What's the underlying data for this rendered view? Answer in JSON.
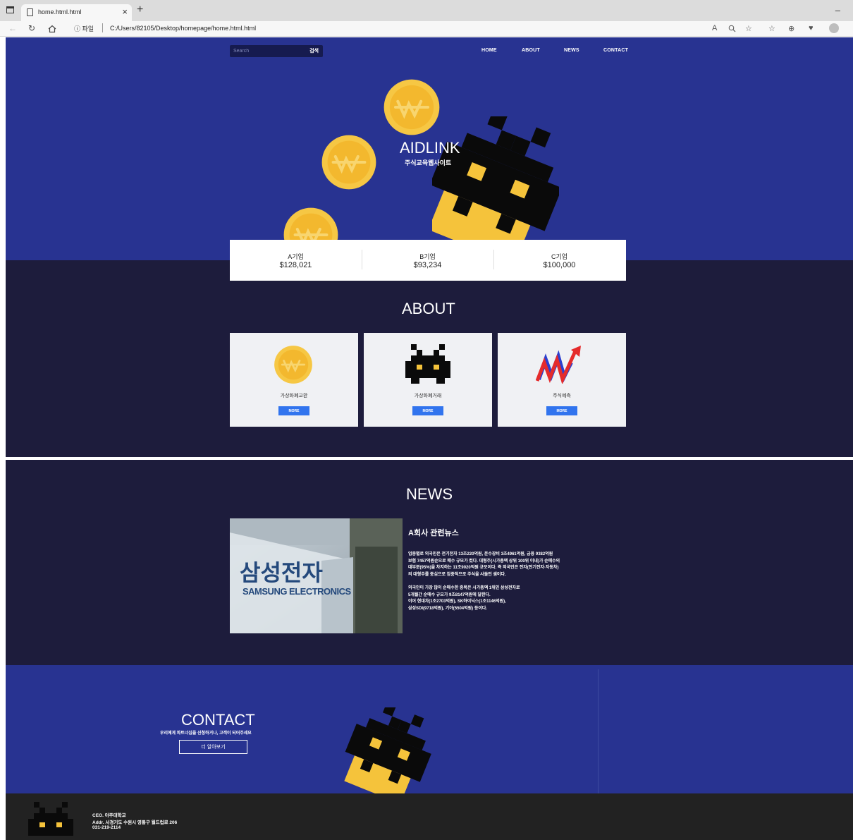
{
  "browser": {
    "tab_title": "home.html.html",
    "tab_close": "×",
    "new_tab": "+",
    "minimize": "–",
    "address_label": "ⓘ 파일",
    "address_url": "C:/Users/82105/Desktop/homepage/home.html.html"
  },
  "header": {
    "search_placeholder": "Search",
    "search_button": "검색",
    "nav": [
      "HOME",
      "ABOUT",
      "NEWS",
      "CONTACT"
    ]
  },
  "hero": {
    "title": "AIDLINK",
    "subtitle": "주식교육웹사이트"
  },
  "stats": [
    {
      "name": "A기업",
      "value": "$128,021"
    },
    {
      "name": "B기업",
      "value": "$93,234"
    },
    {
      "name": "C기업",
      "value": "$100,000"
    }
  ],
  "about": {
    "title": "ABOUT",
    "cards": [
      {
        "label": "가상화폐교환",
        "button": "MORE",
        "icon": "coin-icon"
      },
      {
        "label": "가상화폐거래",
        "button": "MORE",
        "icon": "pixel-monster-icon"
      },
      {
        "label": "주식예측",
        "button": "MORE",
        "icon": "stock-chart-icon"
      }
    ]
  },
  "news": {
    "title": "NEWS",
    "image_text_ko": "삼성전자",
    "image_text_en": "SAMSUNG ELECTRONICS",
    "headline": "A회사 관련뉴스",
    "para1": [
      "업종별로 외국인은 전기전자 13조220억원, 운수장비 3조4961억원, 금융 9382억원",
      "보험 7457억원순으로 매수 규모가 컸다. 대형주(시가총액 상위 100위 이내)가 순매수의",
      "대부분(95%)을 차지하는 11조9020억원 규모이다. 즉 외국인은 전자(전기전자·자동차)",
      "의 대형주를 중심으로 집중적으로 주식을 사들인 셈이다."
    ],
    "para2": [
      "외국인이 가장 많이 순매수한 종목은 시가총액 1위인 삼성전자로",
      "5개월간 순매수 규모가 9조8147억원에 달한다.",
      "이어 현대차(1조2703억원), SK하이닉스(1조1146억원),",
      "삼성SDI(9718억원), 기아(5504억원) 등이다."
    ]
  },
  "contact": {
    "title": "CONTACT",
    "subtitle": "우리에게 파트너십을 신청하거나, 고객이 되어주세요",
    "button": "더 알아보기"
  },
  "footer": {
    "ceo": "CEO. 아주대학교",
    "addr": "Addr. 서경기도 수원시 영통구 월드컵로 206",
    "phone": "031-219-2114"
  },
  "colors": {
    "hero_blue": "#283391",
    "dark_navy": "#1d1c3c",
    "button_blue": "#3174ee",
    "coin_gold": "#f5c33b",
    "footer": "#222222"
  }
}
